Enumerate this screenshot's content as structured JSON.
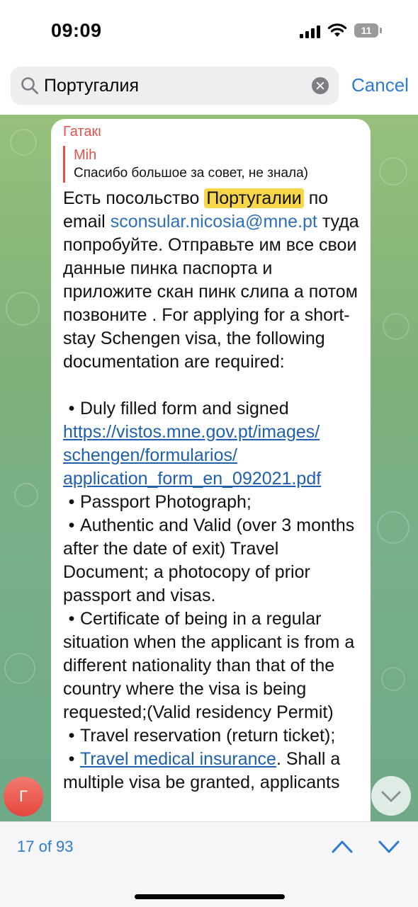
{
  "status": {
    "time": "09:09",
    "battery": "11"
  },
  "search": {
    "query": "Португалия",
    "cancel_label": "Cancel"
  },
  "message": {
    "sender": "Гатакι",
    "reply": {
      "author": "Mih",
      "text": "Спасибо большое за совет, не знала)"
    },
    "text_1": "Есть посольство ",
    "highlight": "Португалии",
    "text_2": "  по email ",
    "email": "sconsular.nicosia@mne.pt",
    "text_3": " туда попробуйте. Отправьте им все свои данные пинка паспорта и приложите скан пинк слипа а потом позвоните . For applying for a short-stay Schengen visa, the following documentation are required:",
    "bullets": [
      "Duly filled form and signed",
      "Passport Photograph;",
      "Authentic and Valid (over 3 months after the date of exit) Travel Document; a photocopy of prior passport and visas.",
      "Certificate of being in a regular situation when the applicant is from a different nationality than that of the country where the visa is being requested;(Valid residency Permit)",
      "Travel reservation (return ticket);",
      "Shall a multiple visa be granted, applicants"
    ],
    "form_link": "https://vistos.mne.gov.pt/images/schengen/formularios/application_form_en_092021.pdf",
    "form_link_lines": [
      "https://vistos.mne.gov.pt/images/",
      "schengen/formularios/",
      "application_form_en_092021.pdf"
    ],
    "insurance_link": "Travel medical insurance",
    "insurance_after": ". "
  },
  "avatar_letter": "Г",
  "bottom": {
    "result_count": "17 of 93"
  },
  "colors": {
    "accent": "#2c7ad4",
    "sender": "#e2524a",
    "highlight": "#f7d748",
    "chat_bg": "#7fb17a"
  },
  "icons": [
    "search-icon",
    "clear-icon",
    "chevron-up-icon",
    "chevron-down-icon",
    "wifi-icon",
    "signal-icon"
  ]
}
